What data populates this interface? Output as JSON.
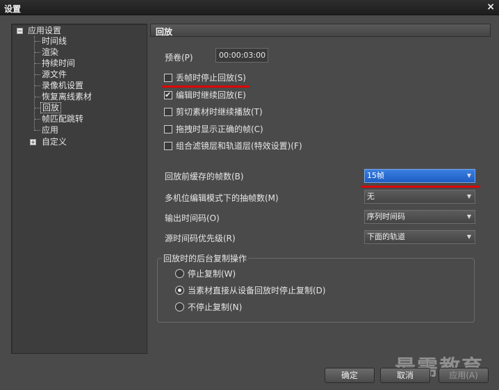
{
  "window": {
    "title": "设置",
    "close_glyph": "×"
  },
  "tree": {
    "root_label": "应用设置",
    "children": [
      "时间线",
      "渲染",
      "持续时间",
      "源文件",
      "录像机设置",
      "恢复离线素材",
      "回放",
      "帧匹配跳转",
      "应用"
    ],
    "selected": "回放",
    "second_root_label": "自定义"
  },
  "panel": {
    "title": "回放",
    "preroll": {
      "label": "预卷(P)",
      "value": "00:00:03:00"
    },
    "checkboxes": [
      {
        "label": "丢帧时停止回放(S)",
        "checked": false
      },
      {
        "label": "编辑时继续回放(E)",
        "checked": true
      },
      {
        "label": "剪切素材时继续播放(T)",
        "checked": false
      },
      {
        "label": "拖拽时显示正确的帧(C)",
        "checked": false
      },
      {
        "label": "组合滤镜层和轨道层(特效设置)(F)",
        "checked": false
      }
    ],
    "dropdowns": [
      {
        "label": "回放前缓存的帧数(B)",
        "value": "15帧"
      },
      {
        "label": "多机位编辑模式下的抽帧数(M)",
        "value": "无"
      },
      {
        "label": "输出时间码(O)",
        "value": "序列时间码"
      },
      {
        "label": "源时间码优先级(R)",
        "value": "下面的轨道"
      }
    ],
    "group": {
      "title": "回放时的后台复制操作",
      "options": [
        {
          "label": "停止复制(W)",
          "selected": false
        },
        {
          "label": "当素材直接从设备回放时停止复制(D)",
          "selected": true
        },
        {
          "label": "不停止复制(N)",
          "selected": false
        }
      ]
    }
  },
  "buttons": {
    "ok": "确定",
    "cancel": "取消",
    "apply": "应用(A)"
  },
  "watermark": "最需教育",
  "colors": {
    "accent_red": "#e00000",
    "selected_blue": "#2a6fd6",
    "background": "#4a4a4a"
  }
}
